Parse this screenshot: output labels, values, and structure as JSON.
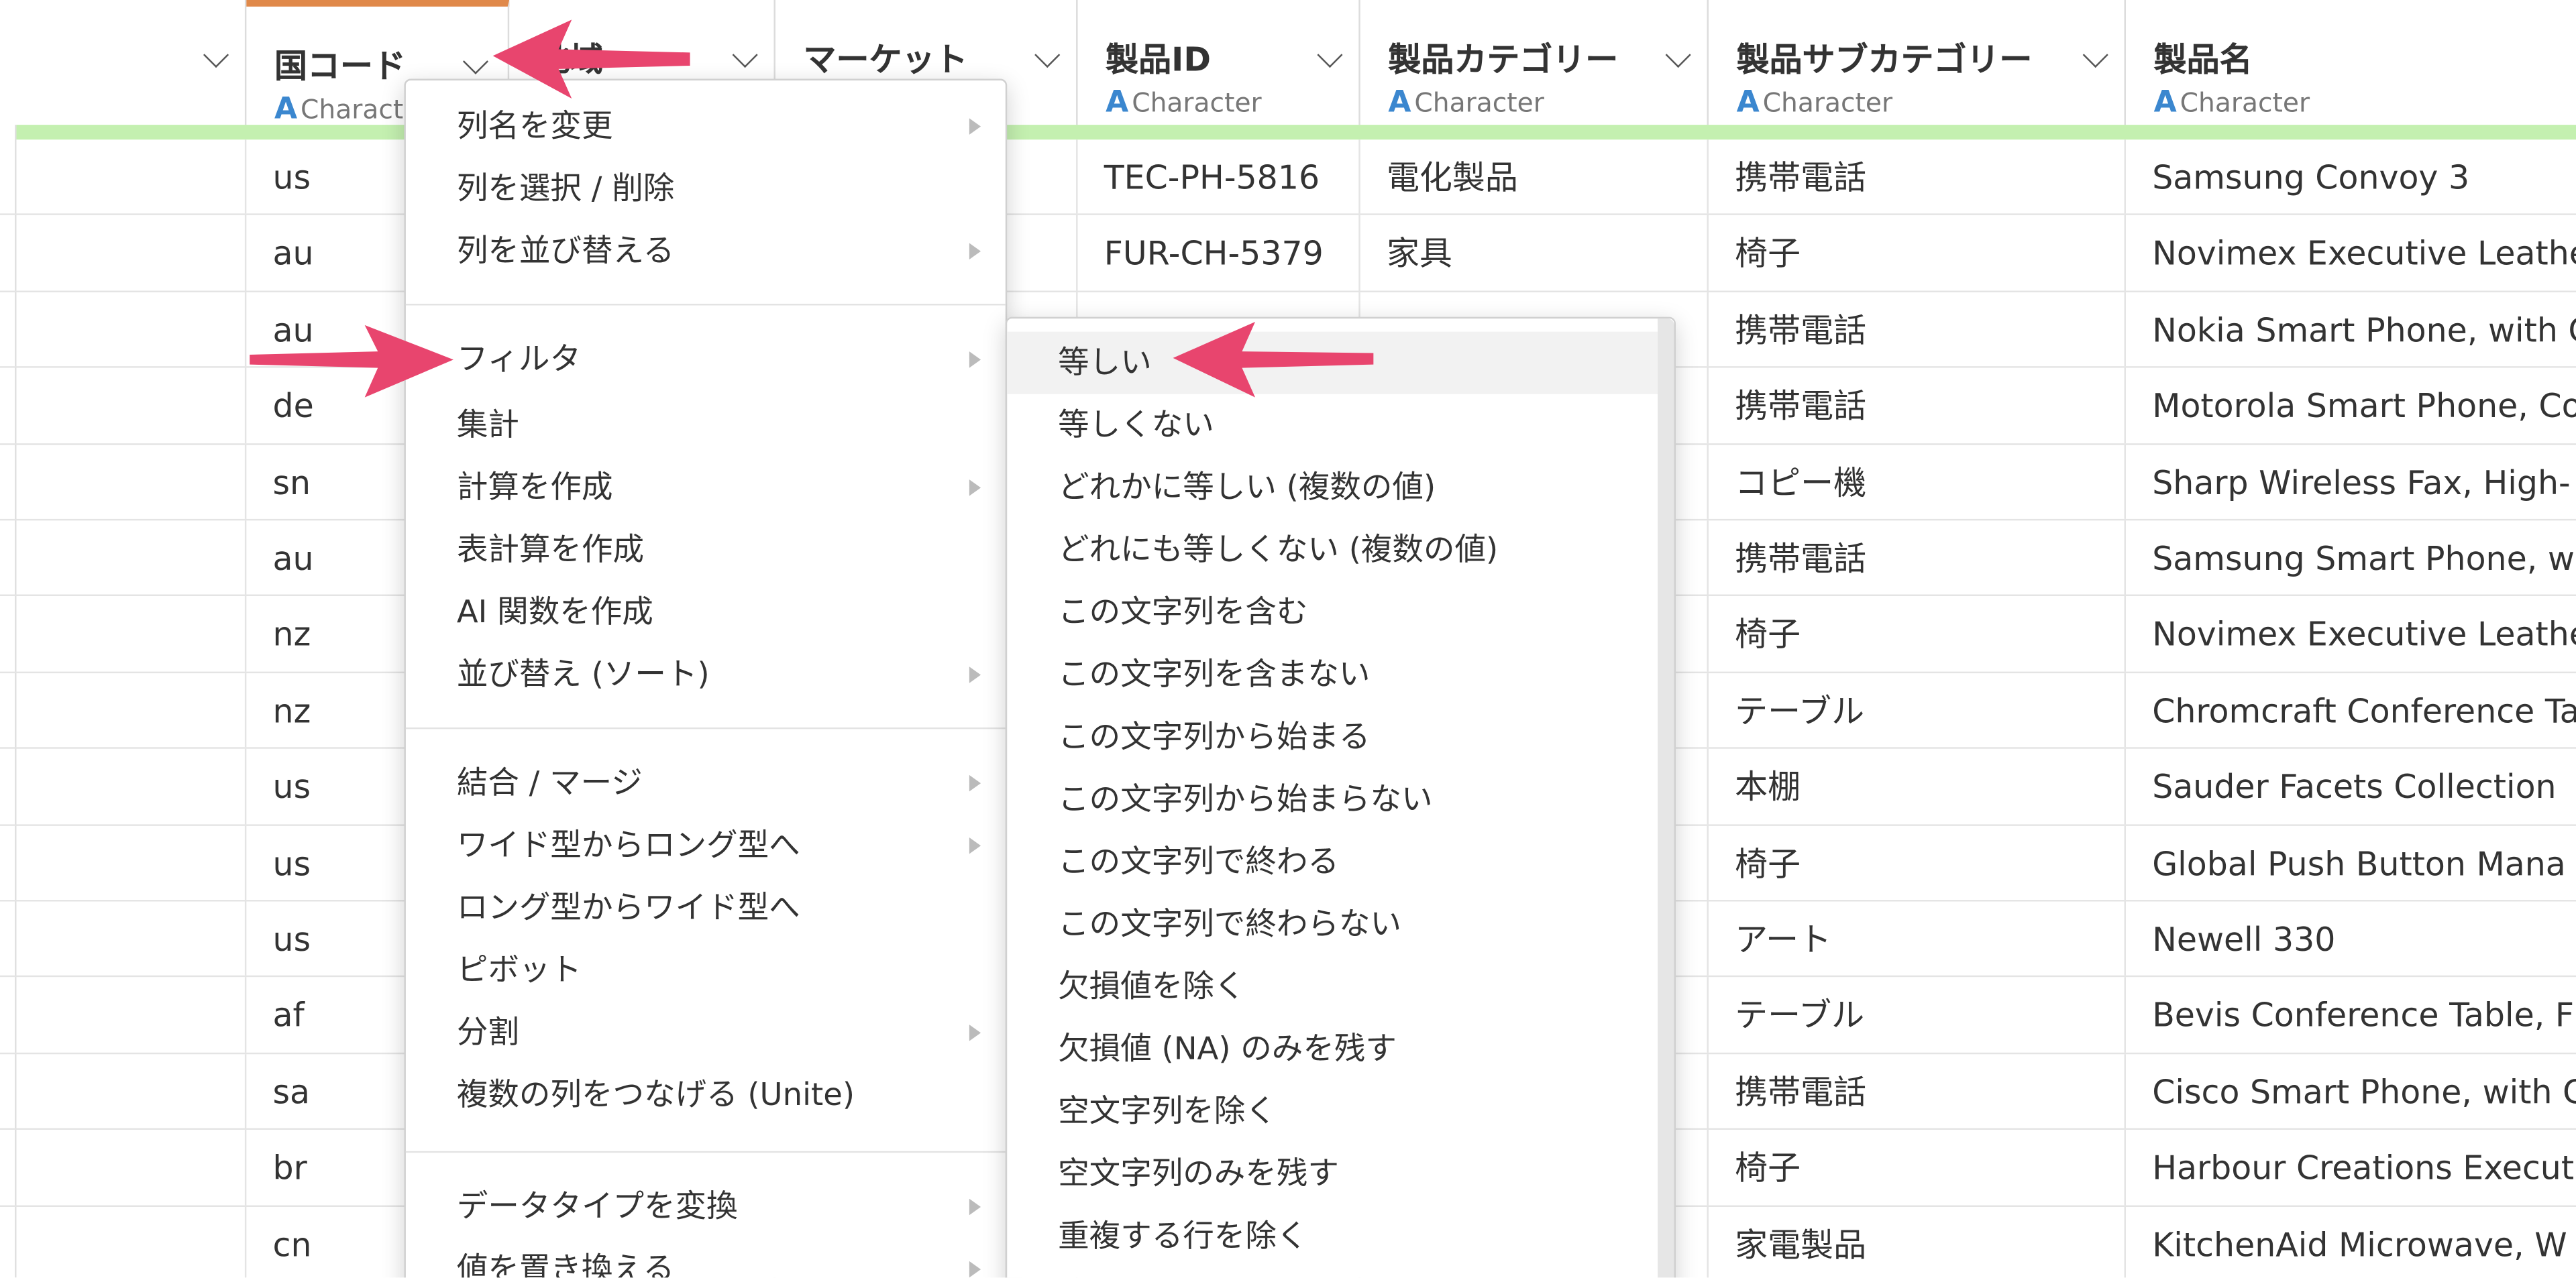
{
  "header": {
    "columns": [
      {
        "title": "",
        "type": ""
      },
      {
        "title": "国コード",
        "type": "Character"
      },
      {
        "title": "地域",
        "type": ""
      },
      {
        "title": "マーケット",
        "type": ""
      },
      {
        "title": "製品ID",
        "type": "Character"
      },
      {
        "title": "製品カテゴリー",
        "type": "Character"
      },
      {
        "title": "製品サブカテゴリー",
        "type": "Character"
      },
      {
        "title": "製品名",
        "type": "Character"
      }
    ],
    "type_icon": "A",
    "partial_type": "Charact"
  },
  "rows": [
    {
      "country": "us",
      "product_id": "TEC-PH-5816",
      "category": "電化製品",
      "subcategory": "携帯電話",
      "name": "Samsung Convoy 3"
    },
    {
      "country": "au",
      "product_id": "FUR-CH-5379",
      "category": "家具",
      "subcategory": "椅子",
      "name": "Novimex Executive Leather"
    },
    {
      "country": "au",
      "product_id": "",
      "category": "",
      "subcategory": "携帯電話",
      "name": "Nokia Smart Phone, with C"
    },
    {
      "country": "de",
      "product_id": "",
      "category": "",
      "subcategory": "携帯電話",
      "name": "Motorola Smart Phone, Co"
    },
    {
      "country": "sn",
      "product_id": "",
      "category": "",
      "subcategory": "コピー機",
      "name": "Sharp Wireless Fax, High-"
    },
    {
      "country": "au",
      "product_id": "",
      "category": "",
      "subcategory": "携帯電話",
      "name": "Samsung Smart Phone, w"
    },
    {
      "country": "nz",
      "product_id": "",
      "category": "",
      "subcategory": "椅子",
      "name": "Novimex Executive Leathe"
    },
    {
      "country": "nz",
      "product_id": "",
      "category": "",
      "subcategory": "テーブル",
      "name": "Chromcraft Conference Ta"
    },
    {
      "country": "us",
      "product_id": "",
      "category": "",
      "subcategory": "本棚",
      "name": "Sauder Facets Collection"
    },
    {
      "country": "us",
      "product_id": "",
      "category": "",
      "subcategory": "椅子",
      "name": "Global Push Button Mana"
    },
    {
      "country": "us",
      "product_id": "",
      "category": "",
      "subcategory": "アート",
      "name": "Newell 330"
    },
    {
      "country": "af",
      "product_id": "",
      "category": "",
      "subcategory": "テーブル",
      "name": "Bevis Conference Table, F"
    },
    {
      "country": "sa",
      "product_id": "",
      "category": "",
      "subcategory": "携帯電話",
      "name": "Cisco Smart Phone, with C"
    },
    {
      "country": "br",
      "product_id": "",
      "category": "",
      "subcategory": "椅子",
      "name": "Harbour Creations Execut"
    },
    {
      "country": "cn",
      "product_id": "",
      "category": "",
      "subcategory": "家電製品",
      "name": "KitchenAid Microwave, W"
    }
  ],
  "context_menu": {
    "items": [
      {
        "label": "列名を変更",
        "submenu": true
      },
      {
        "label": "列を選択 / 削除",
        "submenu": false
      },
      {
        "label": "列を並び替える",
        "submenu": true
      },
      {
        "label": "フィルタ",
        "submenu": true
      },
      {
        "label": "集計",
        "submenu": false
      },
      {
        "label": "計算を作成",
        "submenu": true
      },
      {
        "label": "表計算を作成",
        "submenu": false
      },
      {
        "label": "AI 関数を作成",
        "submenu": false
      },
      {
        "label": "並び替え (ソート)",
        "submenu": true
      },
      {
        "label": "結合 / マージ",
        "submenu": true
      },
      {
        "label": "ワイド型からロング型へ",
        "submenu": true
      },
      {
        "label": "ロング型からワイド型へ",
        "submenu": false
      },
      {
        "label": "ピボット",
        "submenu": false
      },
      {
        "label": "分割",
        "submenu": true
      },
      {
        "label": "複数の列をつなげる (Unite)",
        "submenu": false
      },
      {
        "label": "データタイプを変換",
        "submenu": true
      },
      {
        "label": "値を置き換える",
        "submenu": true
      }
    ]
  },
  "filter_submenu": {
    "items": [
      "等しい",
      "等しくない",
      "どれかに等しい (複数の値)",
      "どれにも等しくない (複数の値)",
      "この文字列を含む",
      "この文字列を含まない",
      "この文字列から始まる",
      "この文字列から始まらない",
      "この文字列で終わる",
      "この文字列で終わらない",
      "欠損値を除く",
      "欠損値 (NA) のみを残す",
      "空文字列を除く",
      "空文字列のみを残す",
      "重複する行を除く"
    ]
  },
  "colors": {
    "accent_orange": "#e0894a",
    "green_bar": "#c4f0b0",
    "type_blue": "#3b87cf",
    "arrow_pink": "#e8456e"
  }
}
